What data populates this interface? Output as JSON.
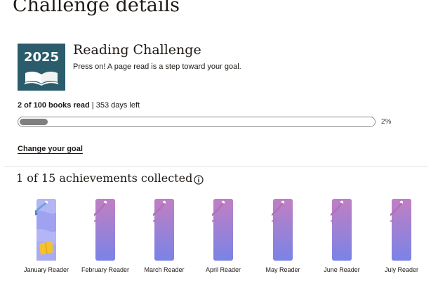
{
  "page": {
    "title": "Challenge details"
  },
  "challenge": {
    "year": "2025",
    "name": "Reading Challenge",
    "tagline": "Press on! A page read is a step toward your goal.",
    "books_read": "2 of 100 books read",
    "separator": " | ",
    "days_left": "353 days left",
    "progress_fraction": 0.02,
    "progress_label": "2%",
    "change_goal_label": "Change your goal"
  },
  "achievements": {
    "heading": "1 of 15 achievements collected",
    "info_icon": "info-icon",
    "items": [
      {
        "label": "January Reader",
        "earned": true
      },
      {
        "label": "February Reader",
        "earned": false
      },
      {
        "label": "March Reader",
        "earned": false
      },
      {
        "label": "April Reader",
        "earned": false
      },
      {
        "label": "May Reader",
        "earned": false
      },
      {
        "label": "June Reader",
        "earned": false
      },
      {
        "label": "July Reader",
        "earned": false
      }
    ]
  },
  "colors": {
    "badge_bg": "#2a5c6b",
    "progress_fill": "#808080",
    "bookmark_top": "#c17fc3",
    "bookmark_bottom": "#7a83e6",
    "earned_bg": "#b3b5f5"
  }
}
